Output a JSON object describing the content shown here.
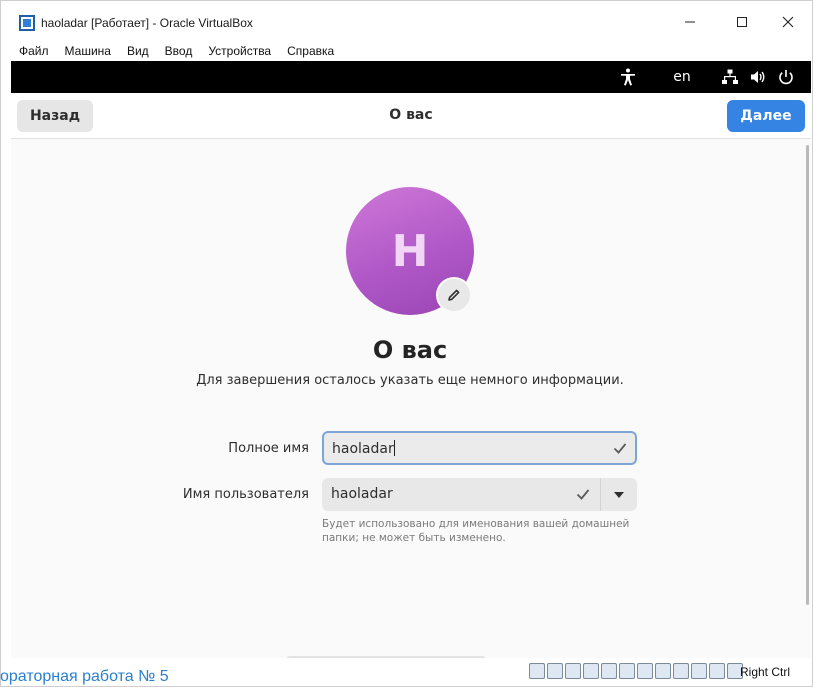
{
  "window": {
    "title": "haoladar [Работает] - Oracle VirtualBox",
    "menu": [
      "Файл",
      "Машина",
      "Вид",
      "Ввод",
      "Устройства",
      "Справка"
    ]
  },
  "guest_topbar": {
    "language": "en",
    "icons": [
      "accessibility-icon",
      "network-icon",
      "volume-icon",
      "power-icon"
    ]
  },
  "header": {
    "back_label": "Назад",
    "title": "О вас",
    "next_label": "Далее"
  },
  "avatar": {
    "initial": "H",
    "colors": [
      "#cf78d8",
      "#9a44b3"
    ]
  },
  "main": {
    "heading": "О вас",
    "subtitle": "Для завершения осталось указать еще немного информации."
  },
  "form": {
    "fullname_label": "Полное имя",
    "fullname_value": "haoladar",
    "username_label": "Имя пользователя",
    "username_value": "haoladar",
    "username_hint": "Будет использовано для именования вашей домашней папки; не может быть изменено."
  },
  "statusbar": {
    "host_key": "Right Ctrl"
  },
  "background": {
    "partial_text": "ораторная работа № 5"
  },
  "colors": {
    "accent": "#3584e4",
    "topbar": "#000000"
  }
}
